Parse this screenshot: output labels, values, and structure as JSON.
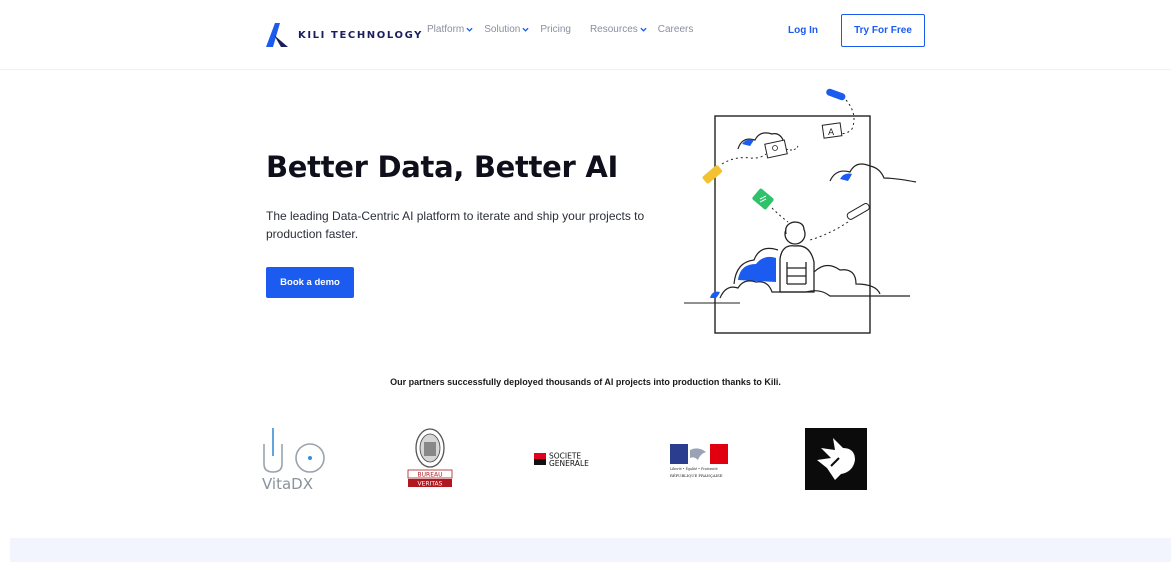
{
  "brand": {
    "name": "KILI TECHNOLOGY",
    "accent": "#1b5bf0",
    "logo_icon": "kili-logo-icon"
  },
  "nav": {
    "items": [
      {
        "label": "Platform",
        "has_dropdown": true
      },
      {
        "label": "Solution",
        "has_dropdown": true
      },
      {
        "label": "Pricing",
        "has_dropdown": false
      },
      {
        "label": "Resources",
        "has_dropdown": true
      },
      {
        "label": "Careers",
        "has_dropdown": false
      }
    ],
    "login_label": "Log In",
    "cta_label": "Try For Free"
  },
  "hero": {
    "title": "Better Data, Better AI",
    "subtitle": "The leading Data-Centric AI platform to iterate and ship your projects to production faster.",
    "button_label": "Book a demo",
    "illustration_icon": "labeling-illustration-icon"
  },
  "partners": {
    "heading": "Our partners successfully deployed thousands of AI projects into production thanks to Kili.",
    "logos": {
      "vitadx": "VitaDX",
      "bureau_veritas_top": "BUREAU",
      "bureau_veritas_bottom": "VERITAS",
      "societe_generale_line1": "SOCIETE",
      "societe_generale_line2": "GENERALE",
      "rf_motto": "Liberté • Égalité • Fraternité",
      "rf_name": "RÉPUBLIQUE FRANÇAISE"
    }
  },
  "colors": {
    "title": "#0e0f1a",
    "nav_text": "#8a8fa0",
    "footer_band": "#f2f5fd"
  }
}
